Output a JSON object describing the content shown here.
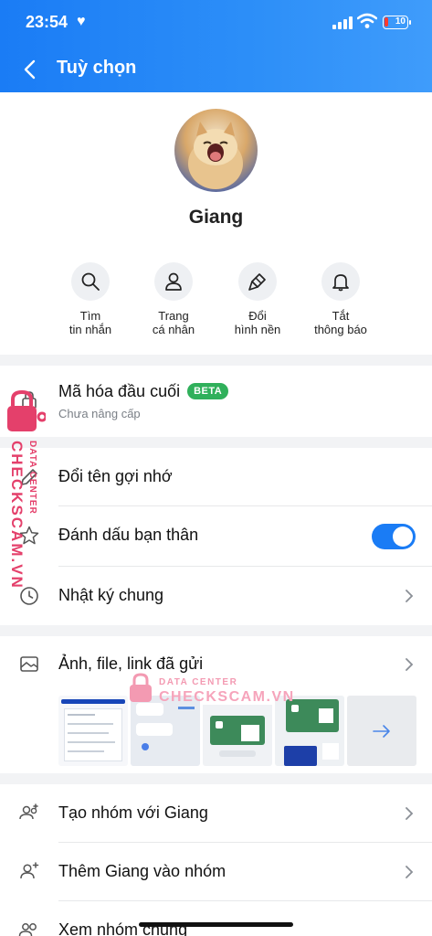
{
  "status_bar": {
    "time": "23:54",
    "battery": "10"
  },
  "header": {
    "title": "Tuỳ chọn"
  },
  "profile": {
    "name": "Giang"
  },
  "quick_actions": [
    {
      "label": "Tìm\ntin nhắn",
      "icon": "search-icon"
    },
    {
      "label": "Trang\ncá nhân",
      "icon": "person-icon"
    },
    {
      "label": "Đổi\nhình nền",
      "icon": "paint-brush-icon"
    },
    {
      "label": "Tắt\nthông báo",
      "icon": "bell-icon"
    }
  ],
  "encryption": {
    "title": "Mã hóa đầu cuối",
    "badge": "BETA",
    "subtitle": "Chưa nâng cấp"
  },
  "settings": {
    "rename": "Đổi tên gợi nhớ",
    "best_friend": "Đánh dấu bạn thân",
    "best_friend_on": true,
    "diary": "Nhật ký chung"
  },
  "media": {
    "title": "Ảnh, file, link đã gửi"
  },
  "group_actions": {
    "create_group": "Tạo nhóm với Giang",
    "add_to_group": "Thêm Giang vào nhóm",
    "common_groups": "Xem nhóm chung"
  },
  "watermark": {
    "brand": "CHECKSCAM.VN",
    "tagline": "DATA CENTER"
  },
  "colors": {
    "header": "#1a7cf5",
    "toggle": "#1a7cf5",
    "beta": "#30b05b",
    "watermark": "#e4406b"
  }
}
